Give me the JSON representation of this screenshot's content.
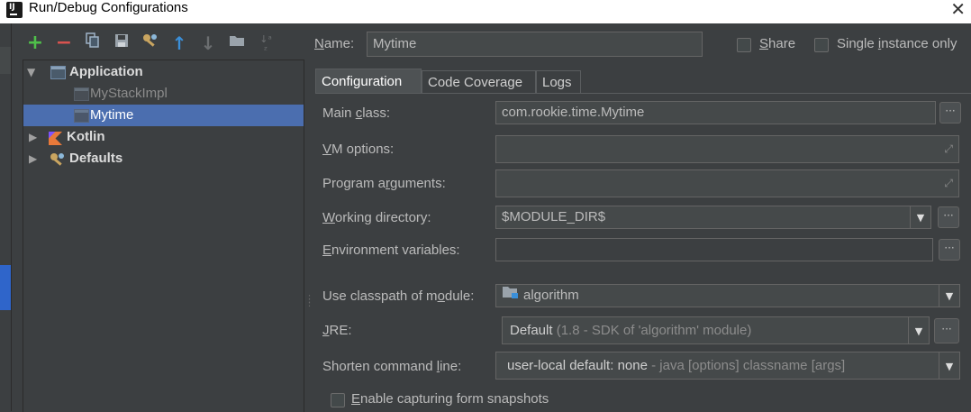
{
  "window": {
    "title": "Run/Debug Configurations"
  },
  "toolbar": {
    "add": "+",
    "remove": "−",
    "copy": "copy-icon",
    "save": "save-icon",
    "edit_defaults": "wrench-icon",
    "move_up": "↑",
    "move_down": "↓",
    "folder": "folder-icon",
    "sort": "sort-icon"
  },
  "tree": {
    "application": "Application",
    "mystackimpl": "MyStackImpl",
    "mytime": "Mytime",
    "kotlin": "Kotlin",
    "defaults": "Defaults"
  },
  "header": {
    "name_label_u": "N",
    "name_label_rest": "ame:",
    "name_value": "Mytime",
    "share_u": "S",
    "share_rest": "hare",
    "single_pre": "Single ",
    "single_u": "i",
    "single_rest": "nstance only"
  },
  "tabs": [
    "Configuration",
    "Code Coverage",
    "Logs"
  ],
  "form": {
    "main_class_pre": "Main ",
    "main_class_u": "c",
    "main_class_rest": "lass:",
    "main_class_value": "com.rookie.time.Mytime",
    "vm_u": "V",
    "vm_rest": "M options:",
    "prog_pre": "Program a",
    "prog_u": "r",
    "prog_rest": "guments:",
    "wd_u": "W",
    "wd_rest": "orking directory:",
    "wd_value": "$MODULE_DIR$",
    "env_u": "E",
    "env_rest": "nvironment variables:",
    "cp_pre": "Use classpath of m",
    "cp_u": "o",
    "cp_rest": "dule:",
    "cp_value": "algorithm",
    "jre_u": "J",
    "jre_rest": "RE:",
    "jre_value": "Default",
    "jre_detail": "(1.8 - SDK of 'algorithm' module)",
    "shorten_pre": "Shorten command ",
    "shorten_u": "l",
    "shorten_rest": "ine:",
    "shorten_value": "user-local default: none",
    "shorten_detail": "- java [options] classname [args]",
    "snap_u": "E",
    "snap_rest": "nable capturing form snapshots"
  },
  "buttons": {
    "ellipsis": "···"
  },
  "colors": {
    "accent": "#4b6eaf",
    "background": "#3c3f41",
    "field": "#45494a",
    "kotlin_orange": "#e8793a",
    "add_green": "#4fc04a",
    "remove_red": "#d9534f",
    "up_blue": "#3a8fd9"
  }
}
